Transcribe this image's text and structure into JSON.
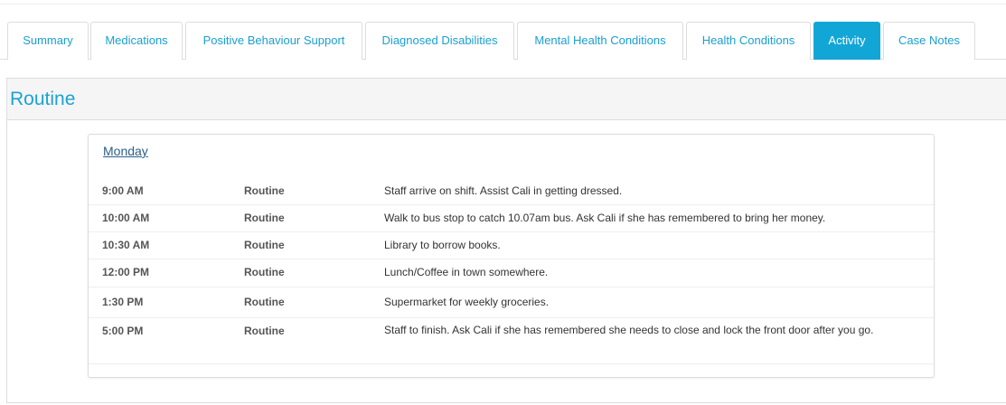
{
  "tabs": [
    {
      "label": "Summary",
      "active": false
    },
    {
      "label": "Medications",
      "active": false
    },
    {
      "label": "Positive Behaviour Support",
      "active": false
    },
    {
      "label": "Diagnosed Disabilities",
      "active": false
    },
    {
      "label": "Mental Health Conditions",
      "active": false
    },
    {
      "label": "Health Conditions",
      "active": false
    },
    {
      "label": "Activity",
      "active": true
    },
    {
      "label": "Case Notes",
      "active": false
    }
  ],
  "panel": {
    "title": "Routine"
  },
  "schedule": {
    "day": "Monday",
    "rows": [
      {
        "time": "9:00 AM",
        "type": "Routine",
        "description": "Staff arrive on shift. Assist Cali in getting dressed."
      },
      {
        "time": "10:00 AM",
        "type": "Routine",
        "description": "Walk to bus stop to catch 10.07am bus. Ask Cali if she has remembered to bring her money."
      },
      {
        "time": "10:30 AM",
        "type": "Routine",
        "description": "Library to borrow books."
      },
      {
        "time": "12:00 PM",
        "type": "Routine",
        "description": "Lunch/Coffee in town somewhere."
      },
      {
        "time": "1:30 PM",
        "type": "Routine",
        "description": "Supermarket for weekly groceries."
      },
      {
        "time": "5:00 PM",
        "type": "Routine",
        "description": "Staff to finish. Ask Cali if she has remembered she needs to close and lock the front door after you go."
      }
    ]
  },
  "colors": {
    "accent": "#12a6d6",
    "link": "#1a9fd0",
    "title": "#1aa3d4"
  }
}
